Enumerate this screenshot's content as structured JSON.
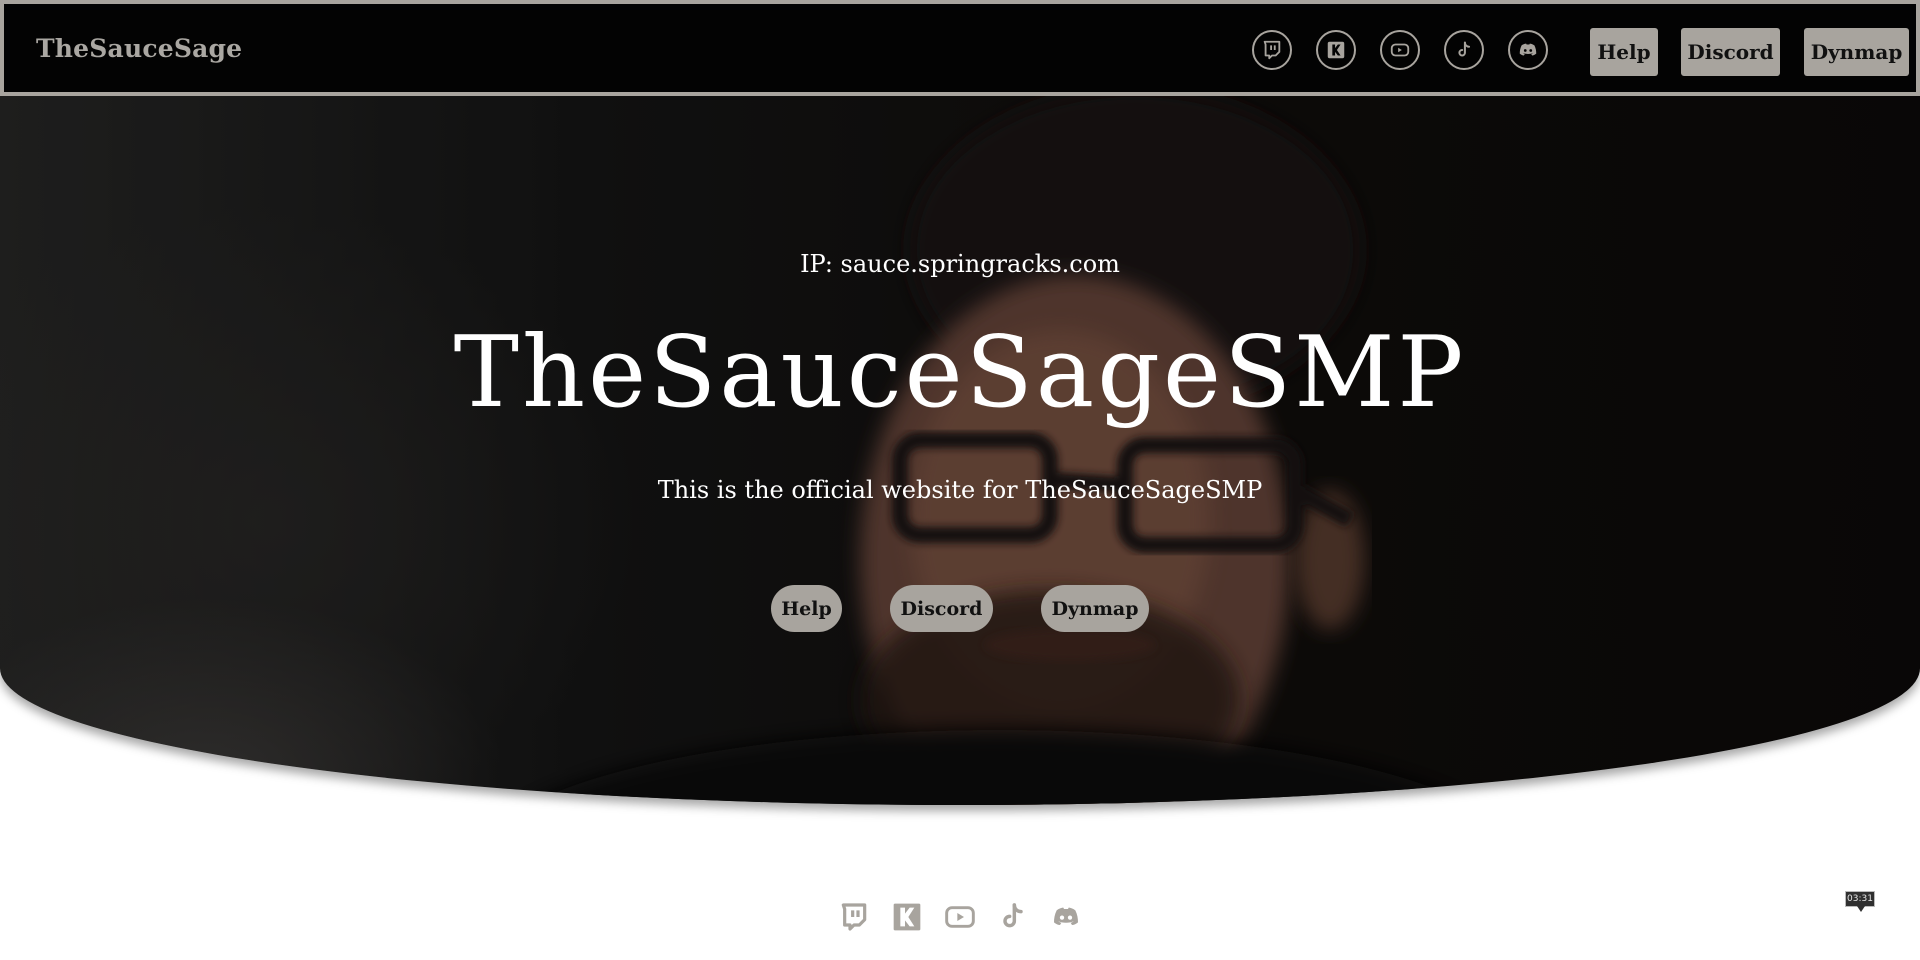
{
  "navbar": {
    "brand": "TheSauceSage",
    "social_icons": [
      "twitch-icon",
      "kick-icon",
      "youtube-icon",
      "tiktok-icon",
      "discord-icon"
    ],
    "buttons": {
      "help": "Help",
      "discord": "Discord",
      "dynmap": "Dynmap"
    }
  },
  "hero": {
    "ip": "IP: sauce.springracks.com",
    "title": "TheSauceSageSMP",
    "subtitle": "This is the official website for TheSauceSageSMP",
    "buttons": {
      "help": "Help",
      "discord": "Discord",
      "dynmap": "Dynmap"
    }
  },
  "footer": {
    "social_icons": [
      "twitch-icon",
      "kick-icon",
      "youtube-icon",
      "tiktok-icon",
      "discord-icon"
    ]
  },
  "clock": {
    "time": "03:31"
  },
  "colors": {
    "nav_background": "#030303",
    "accent_gray": "#a8a49e",
    "brand_text": "#aaa7a2",
    "hero_text": "#ffffff"
  }
}
